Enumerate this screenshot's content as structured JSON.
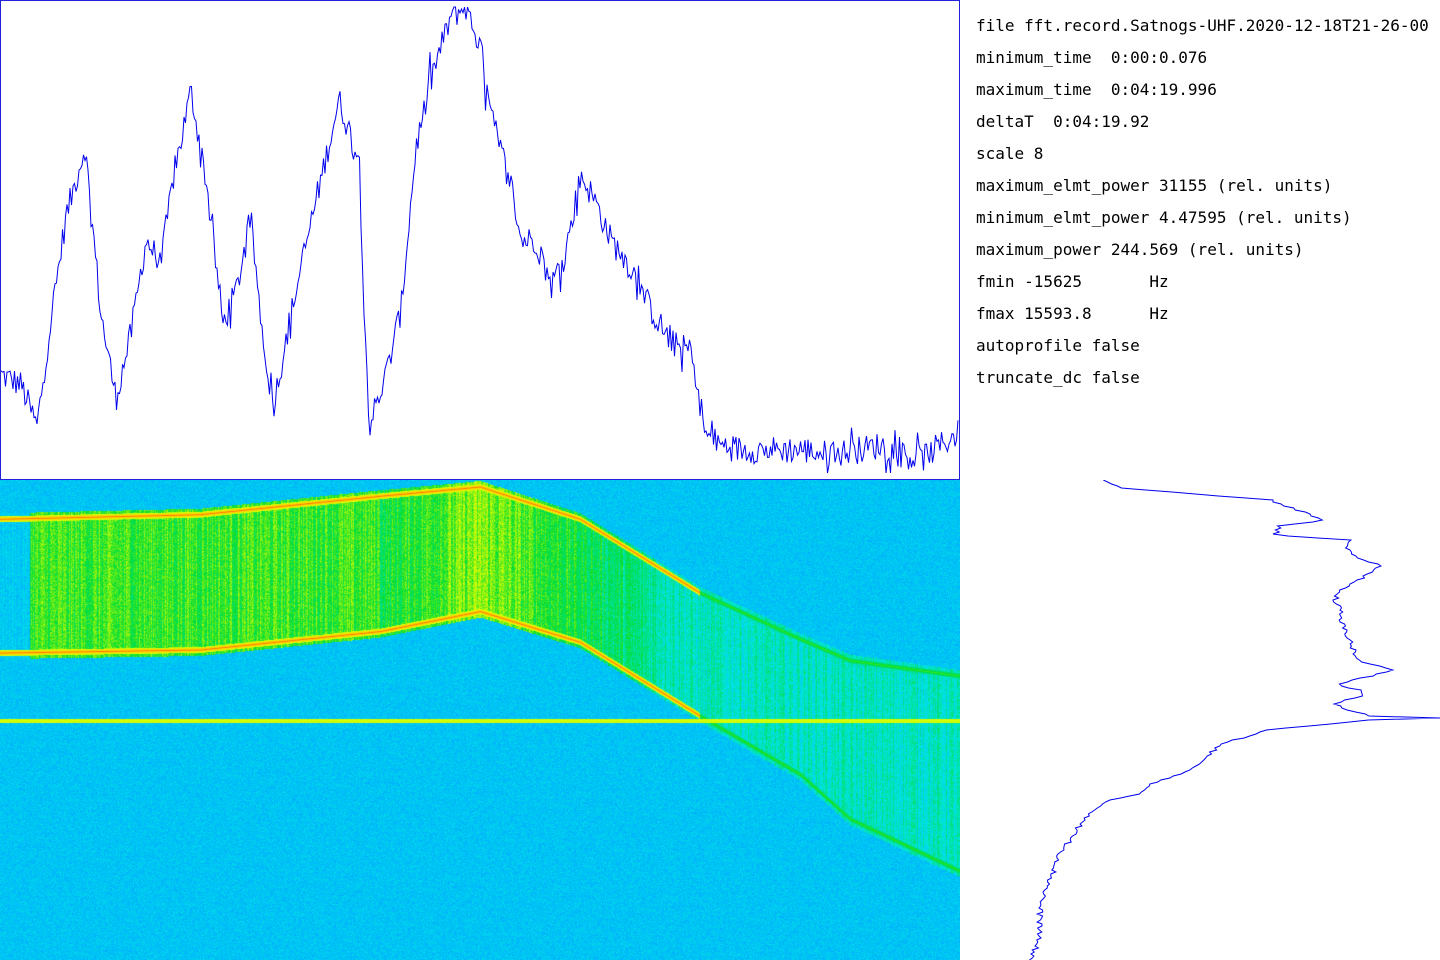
{
  "colors": {
    "profile_line": "#0000ee",
    "frame": "#2222dd",
    "colormap": [
      "#1e64ff",
      "#00aaff",
      "#00e6e6",
      "#00dd33",
      "#ddff00",
      "#ffcc00",
      "#ff2200"
    ]
  },
  "info": {
    "file": "file fft.record.Satnogs-UHF.2020-12-18T21-26-00",
    "minimum_time": "minimum_time  0:00:0.076",
    "maximum_time": "maximum_time  0:04:19.996",
    "deltaT": "deltaT  0:04:19.92",
    "scale": "scale 8",
    "maximum_elmt_power": "maximum_elmt_power 31155 (rel. units)",
    "minimum_elmt_power": "minimum_elmt_power 4.47595 (rel. units)",
    "maximum_power": "maximum_power 244.569 (rel. units)",
    "fmin": "fmin -15625       Hz",
    "fmax": "fmax 15593.8      Hz",
    "autoprofile": "autoprofile false",
    "truncate_dc": "truncate_dc false"
  },
  "chart_data": [
    {
      "type": "line",
      "series": [
        {
          "x": [
            0,
            20,
            36,
            50,
            65,
            84,
            100,
            115,
            130,
            145,
            160,
            172,
            190,
            205,
            222,
            235,
            250,
            262,
            272,
            290,
            305,
            322,
            338,
            358,
            368,
            385,
            400,
            415,
            432,
            450,
            465,
            480,
            487,
            493,
            510,
            520,
            535,
            550,
            565,
            580,
            595,
            610,
            630,
            650,
            670,
            690,
            705,
            720,
            740,
            770,
            800,
            830,
            860,
            880,
            900,
            920,
            940,
            960
          ],
          "y": [
            21,
            19,
            10,
            33,
            55,
            70,
            34,
            16,
            30,
            50,
            45,
            63,
            82,
            63,
            32,
            39,
            54,
            29,
            14,
            34,
            49,
            65,
            80,
            67,
            10,
            21,
            35,
            70,
            86,
            98,
            100,
            91,
            80,
            74,
            62,
            50,
            50,
            40,
            48,
            64,
            58,
            50,
            44,
            35,
            28,
            26,
            8,
            6,
            5,
            5,
            5,
            4,
            5,
            6,
            4,
            3,
            6,
            9
          ]
        }
      ],
      "ylim": [
        0,
        100
      ]
    },
    {
      "type": "heatmap",
      "x_range": [
        0.076,
        259.996
      ],
      "y_range": [
        -15625,
        15593.8
      ],
      "bands": [
        {
          "x": [
            0,
            200,
            380,
            480,
            580,
            700,
            800,
            850,
            960
          ],
          "f": [
            -13100,
            -13400,
            -14600,
            -15200,
            -13100,
            -8300,
            -5300,
            -3900,
            -2900
          ]
        },
        {
          "x": [
            0,
            200,
            380,
            480,
            580,
            700,
            800,
            850,
            960
          ],
          "f": [
            -4400,
            -4600,
            -5800,
            -7100,
            -5100,
            -300,
            3500,
            6400,
            9800
          ]
        }
      ],
      "dc_line_f": 0,
      "bright_columns_x": [
        [
          30,
          380
        ],
        [
          380,
          700
        ]
      ],
      "peak_x": 480
    },
    {
      "type": "line",
      "series": [
        {
          "y": [
            0,
            8,
            20,
            24,
            40,
            46,
            55,
            60,
            65,
            75,
            85,
            100,
            110,
            120,
            130,
            140,
            160,
            175,
            182,
            190,
            200,
            205,
            210,
            215,
            220,
            225,
            232,
            236,
            238,
            240,
            244,
            250,
            256,
            262,
            270,
            278,
            290,
            305,
            315,
            320,
            330,
            345,
            360,
            375,
            400,
            425,
            450,
            470,
            480
          ],
          "x": [
            142,
            160,
            310,
            320,
            365,
            320,
            315,
            390,
            385,
            390,
            420,
            400,
            380,
            375,
            380,
            380,
            390,
            395,
            400,
            435,
            395,
            375,
            400,
            405,
            385,
            375,
            395,
            410,
            480,
            410,
            370,
            305,
            290,
            265,
            255,
            245,
            230,
            190,
            175,
            150,
            135,
            120,
            110,
            100,
            90,
            80,
            80,
            75,
            70
          ]
        }
      ],
      "xlim": [
        0,
        480
      ]
    }
  ]
}
